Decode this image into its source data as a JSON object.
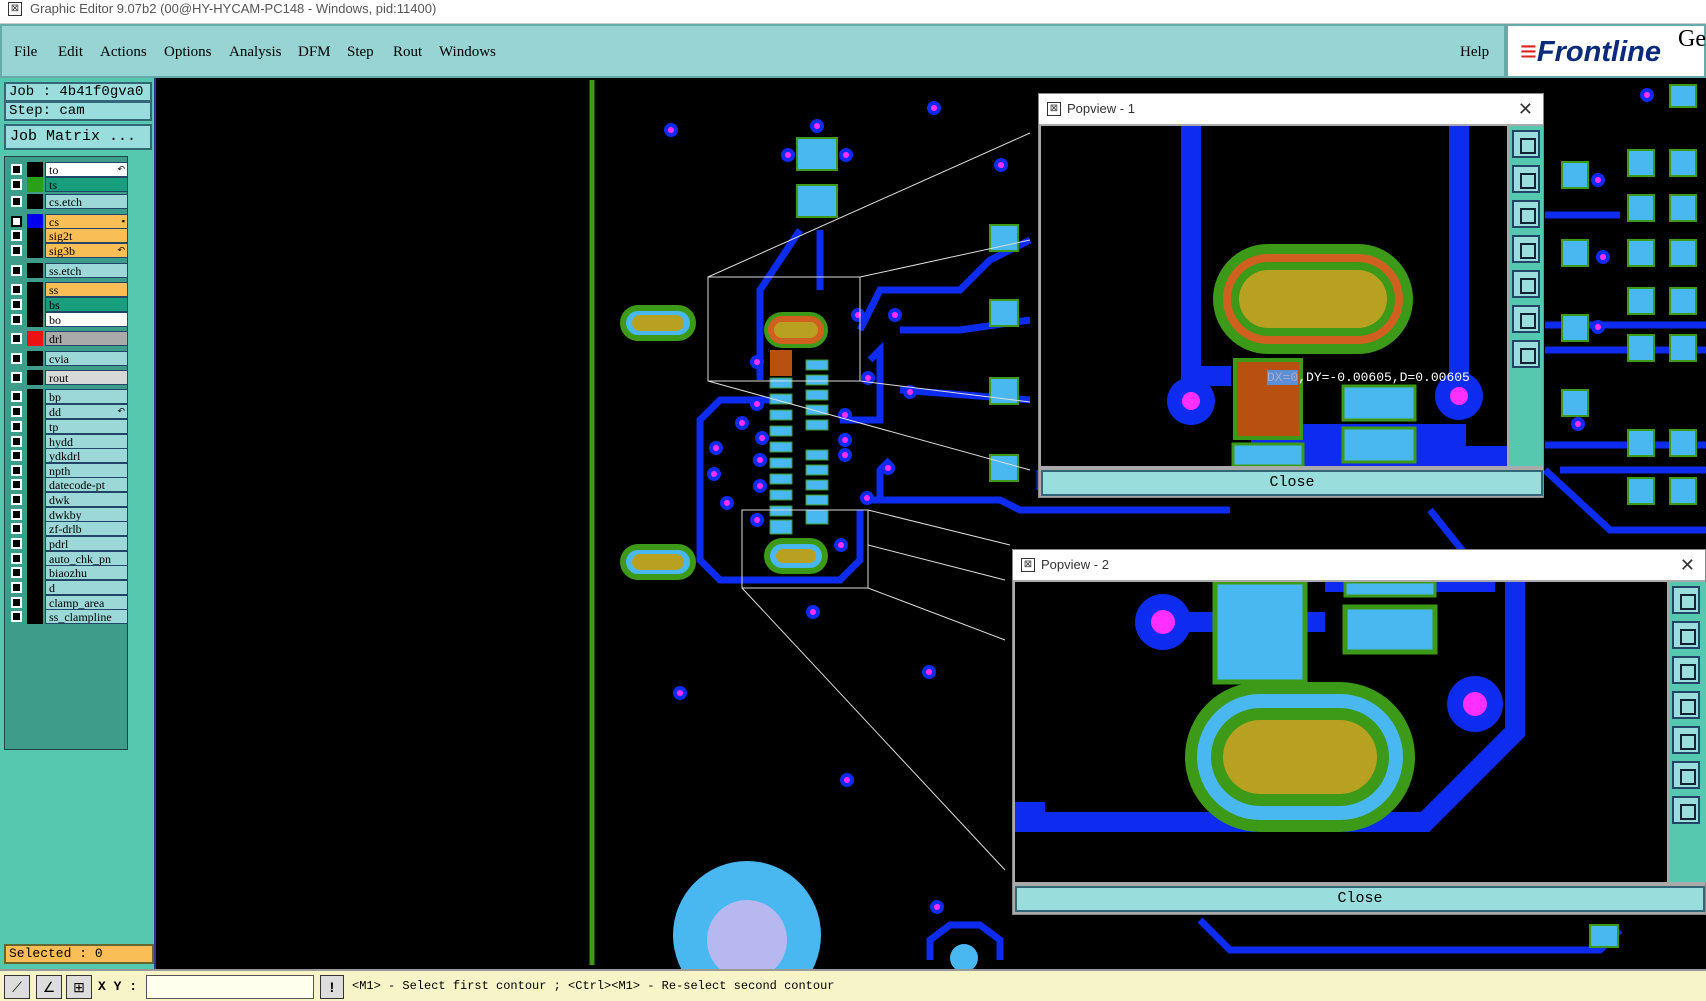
{
  "window": {
    "title": "Graphic Editor 9.07b2 (00@HY-HYCAM-PC148 - Windows, pid:11400)"
  },
  "menu": {
    "file": "File",
    "edit": "Edit",
    "actions": "Actions",
    "options": "Options",
    "analysis": "Analysis",
    "dfm": "DFM",
    "step": "Step",
    "rout": "Rout",
    "windows": "Windows",
    "help": "Help"
  },
  "logo": {
    "text": "Frontline",
    "ge": "Ge"
  },
  "job": {
    "label": "Job : 4b41f0gva0",
    "step": "Step: cam",
    "matrix_button": "Job Matrix ..."
  },
  "layers": [
    {
      "name": "to",
      "color": "#ffffff",
      "swatch": "#000000",
      "ind": "↶"
    },
    {
      "name": "ts",
      "color": "#169e7d",
      "swatch": "#2aa018"
    },
    {
      "name": "cs.etch",
      "color": "#9dd8d8",
      "swatch": "#000000"
    },
    {
      "name": "cs",
      "color": "#f9be55",
      "swatch": "#0000ee",
      "checked": true,
      "ind": "▪"
    },
    {
      "name": "sig2t",
      "color": "#f9be55",
      "swatch": "#000000"
    },
    {
      "name": "sig3b",
      "color": "#f9be55",
      "swatch": "#000000",
      "ind": "↶"
    },
    {
      "name": "ss.etch",
      "color": "#9dd8d8",
      "swatch": "#000000"
    },
    {
      "name": "ss",
      "color": "#f9be55",
      "swatch": "#000000"
    },
    {
      "name": "bs",
      "color": "#169e7d",
      "swatch": "#000000"
    },
    {
      "name": "bo",
      "color": "#ffffff",
      "swatch": "#000000"
    },
    {
      "name": "drl",
      "color": "#aaaaaa",
      "swatch": "#ee1111"
    },
    {
      "name": "cvia",
      "color": "#9dd8d8",
      "swatch": "#000000"
    },
    {
      "name": "rout",
      "color": "#d8d8d8",
      "swatch": "#000000"
    },
    {
      "name": "bp",
      "color": "#9dd8d8",
      "swatch": "#000000"
    },
    {
      "name": "dd",
      "color": "#9dd8d8",
      "swatch": "#000000",
      "ind": "↶"
    },
    {
      "name": "tp",
      "color": "#9dd8d8",
      "swatch": "#000000"
    },
    {
      "name": "hydd",
      "color": "#9dd8d8",
      "swatch": "#000000"
    },
    {
      "name": "ydkdrl",
      "color": "#9dd8d8",
      "swatch": "#000000"
    },
    {
      "name": "npth",
      "color": "#9dd8d8",
      "swatch": "#000000"
    },
    {
      "name": "datecode-pt",
      "color": "#9dd8d8",
      "swatch": "#000000"
    },
    {
      "name": "dwk",
      "color": "#9dd8d8",
      "swatch": "#000000"
    },
    {
      "name": "dwkby",
      "color": "#9dd8d8",
      "swatch": "#000000"
    },
    {
      "name": "zf-drlb",
      "color": "#9dd8d8",
      "swatch": "#000000"
    },
    {
      "name": "pdrl",
      "color": "#9dd8d8",
      "swatch": "#000000"
    },
    {
      "name": "auto_chk_pn",
      "color": "#9dd8d8",
      "swatch": "#000000"
    },
    {
      "name": "biaozhu",
      "color": "#9dd8d8",
      "swatch": "#000000"
    },
    {
      "name": "d",
      "color": "#9dd8d8",
      "swatch": "#000000"
    },
    {
      "name": "clamp_area",
      "color": "#9dd8d8",
      "swatch": "#000000"
    },
    {
      "name": "ss_clampline",
      "color": "#9dd8d8",
      "swatch": "#000000"
    }
  ],
  "selected": "Selected : 0",
  "popview1": {
    "title": "Popview - 1",
    "close": "Close",
    "measure": {
      "dx": "DX=0",
      "rest": ",DY=-0.00605,D=0.00605"
    }
  },
  "popview2": {
    "title": "Popview - 2",
    "close": "Close"
  },
  "statusbar": {
    "xy_label": "X Y :",
    "xy_value": "",
    "prompt": "<M1> - Select first contour ; <Ctrl><M1> - Re-select second contour"
  }
}
